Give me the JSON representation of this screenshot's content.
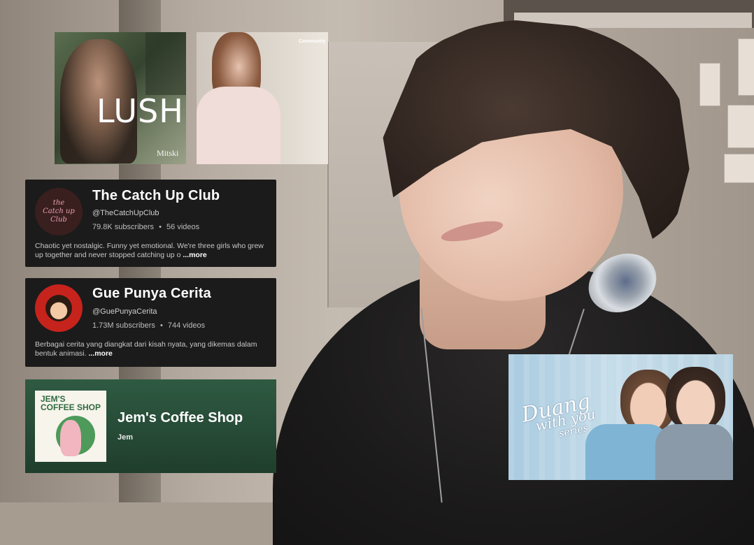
{
  "albums": [
    {
      "title": "LUSH",
      "artist": "Mitski"
    },
    {
      "badge": "Community"
    }
  ],
  "channels": [
    {
      "avatar_text": [
        "the",
        "Catch up",
        "Club"
      ],
      "name": "The Catch Up Club",
      "handle": "@TheCatchUpClub",
      "subscribers": "79.8K subscribers",
      "videos": "56 videos",
      "description": "Chaotic yet nostalgic. Funny yet emotional. We're three girls who grew up together and never stopped catching up o",
      "more": "...more"
    },
    {
      "name": "Gue Punya Cerita",
      "handle": "@GuePunyaCerita",
      "subscribers": "1.73M subscribers",
      "videos": "744 videos",
      "description": "Berbagai cerita yang diangkat dari kisah nyata, yang dikemas dalam bentuk animasi.",
      "more": "...more"
    }
  ],
  "playlist": {
    "cover_text": [
      "JEM'S",
      "COFFEE SHOP"
    ],
    "title": "Jem's Coffee Shop",
    "owner": "Jem"
  },
  "series": {
    "title": "Duang",
    "subtitle": "with you",
    "tag": "series"
  },
  "separator": "•",
  "colors": {
    "card_bg": "#1b1b1b",
    "spotify_green": "#2f5a42",
    "catchup_avatar": "#3a1f1f",
    "gpc_avatar": "#c7231d"
  }
}
